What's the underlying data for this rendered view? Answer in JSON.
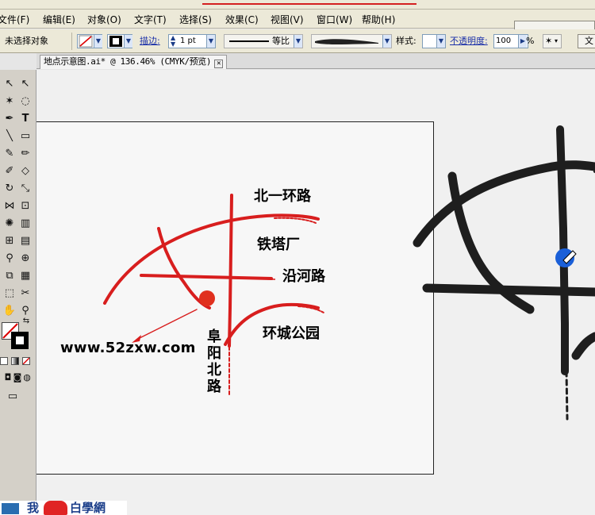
{
  "menubar": {
    "items": [
      "文件(F)",
      "编辑(E)",
      "对象(O)",
      "文字(T)",
      "选择(S)",
      "效果(C)",
      "视图(V)",
      "窗口(W)",
      "帮助(H)"
    ]
  },
  "control_bar": {
    "selection_status": "未选择对象",
    "stroke_label": "描边:",
    "stroke_weight": "1 pt",
    "stroke_profile": "等比",
    "style_label": "样式:",
    "opacity_label": "不透明度:",
    "opacity_value": "100",
    "opacity_unit": "%",
    "right_button": "文"
  },
  "document_tab": {
    "title": "地点示意图.ai* @ 136.46% (CMYK/预览)"
  },
  "map": {
    "roads": [
      "北一环路",
      "铁塔厂",
      "沿河路",
      "环城公园"
    ],
    "vertical_road": [
      "阜",
      "阳",
      "北",
      "路"
    ],
    "url": "www.52zxw.com"
  },
  "watermark": {
    "text": "我",
    "text2": "白學網"
  },
  "colors": {
    "road_red": "#d81e1e",
    "dot_red": "#e0301e",
    "brush_dark": "#1e1e1e",
    "cursor_blue": "#1a5fd8"
  }
}
